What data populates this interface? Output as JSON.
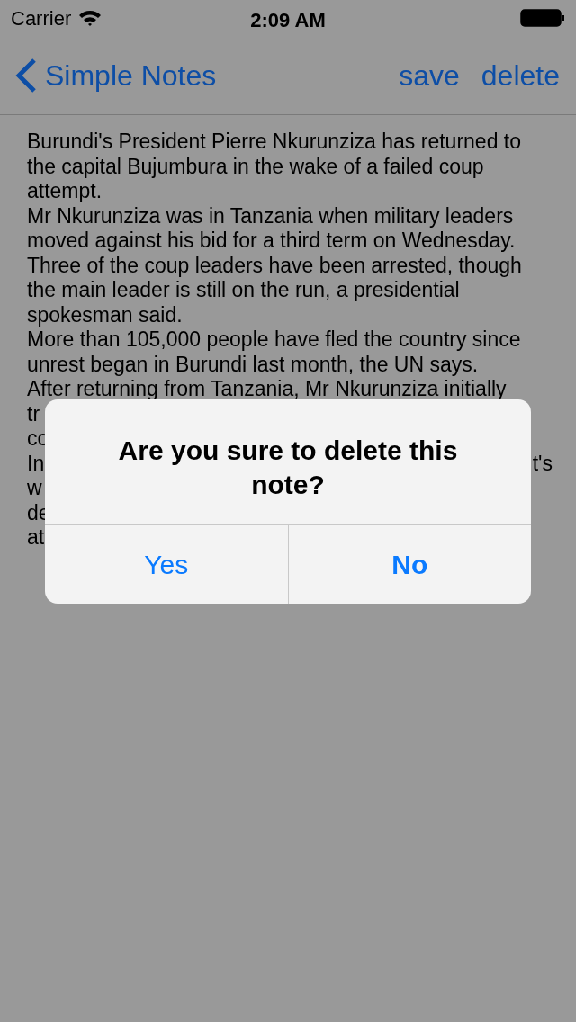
{
  "status_bar": {
    "carrier": "Carrier",
    "time": "2:09 AM"
  },
  "nav_bar": {
    "back_label": "Simple Notes",
    "actions": [
      "save",
      "delete"
    ]
  },
  "note": {
    "paragraphs": [
      "Burundi's President Pierre Nkurunziza has returned to the capital Bujumbura in the wake of a failed coup attempt.",
      "Mr Nkurunziza was in Tanzania when military leaders moved against his bid for a third term on Wednesday.",
      "Three of the coup leaders have been arrested, though the main leader is still on the run, a presidential spokesman said.",
      "More than 105,000 people have fled the country since unrest began in Burundi last month, the UN says.",
      "After returning from Tanzania, Mr Nkurunziza initially"
    ],
    "covered_lines": [
      {
        "start": "tr"
      },
      {
        "start": "co"
      },
      {
        "start": "In",
        "end": "t's"
      },
      {
        "start": "w"
      },
      {
        "start": "de"
      },
      {
        "start": "at"
      }
    ]
  },
  "alert": {
    "title": "Are you sure to delete this note?",
    "buttons": [
      {
        "label": "Yes",
        "kind": "default"
      },
      {
        "label": "No",
        "kind": "preferred"
      }
    ]
  }
}
